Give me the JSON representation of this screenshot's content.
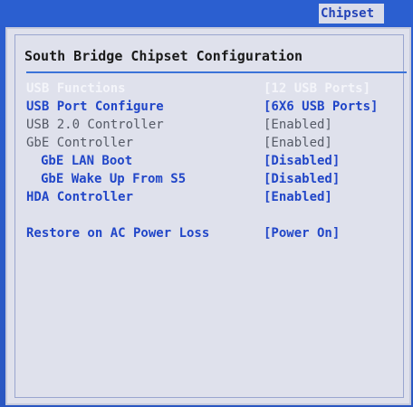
{
  "tabs": {
    "active": "Chipset"
  },
  "page": {
    "title": "South Bridge Chipset Configuration"
  },
  "settings": [
    {
      "label": "USB Functions",
      "value": "[12 USB Ports]",
      "state": "selected"
    },
    {
      "label": "USB Port Configure",
      "value": "[6X6 USB Ports]",
      "state": "editable"
    },
    {
      "label": "USB 2.0 Controller",
      "value": "[Enabled]",
      "state": "readonly"
    },
    {
      "label": "GbE Controller",
      "value": "[Enabled]",
      "state": "readonly"
    },
    {
      "label": "GbE LAN Boot",
      "value": "[Disabled]",
      "state": "editable"
    },
    {
      "label": "GbE Wake Up From S5",
      "value": "[Disabled]",
      "state": "editable"
    },
    {
      "label": "HDA Controller",
      "value": "[Enabled]",
      "state": "editable"
    },
    {
      "label": "Restore on AC Power Loss",
      "value": "[Power On]",
      "state": "editable"
    }
  ],
  "colors": {
    "background_blue": "#2b5fd0",
    "panel_gray": "#dfe1ec",
    "editable_text": "#2146c8",
    "readonly_text": "#555a66",
    "selected_text": "#f4f5fa"
  }
}
